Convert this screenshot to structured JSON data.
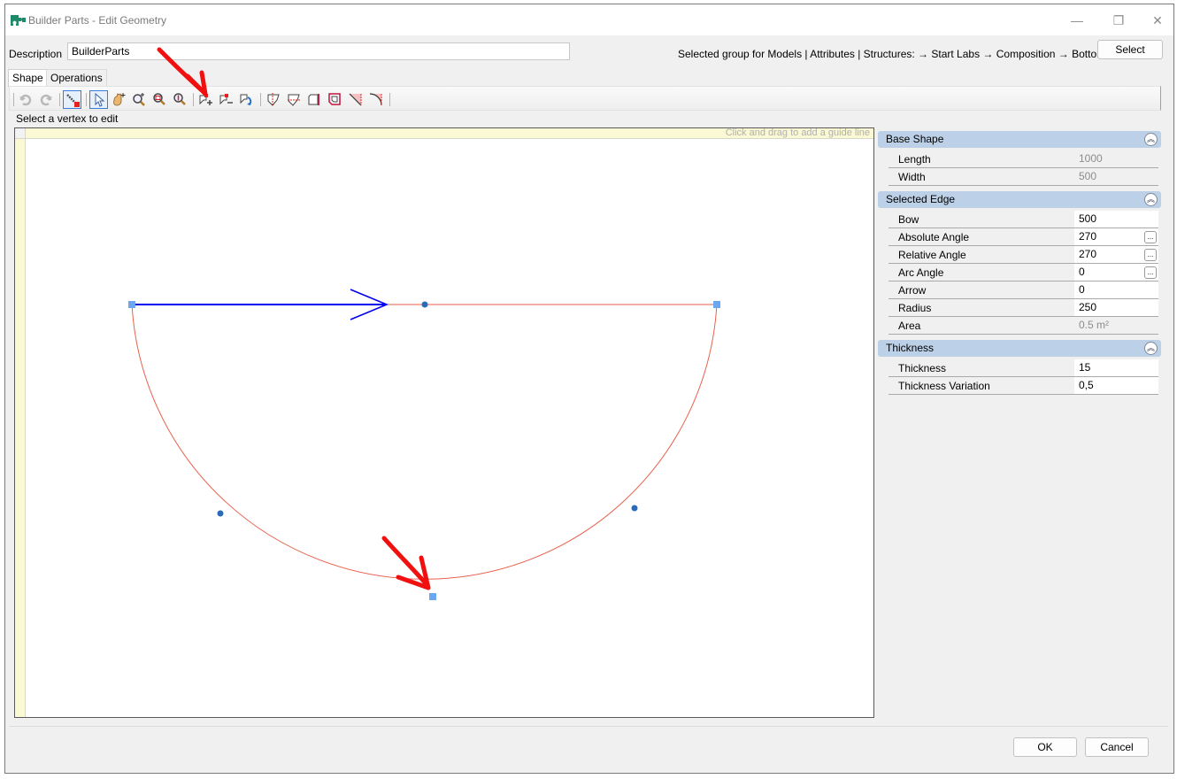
{
  "window": {
    "title": "Builder Parts - Edit Geometry",
    "controls": {
      "minimize": "—",
      "maximize": "❐",
      "close": "✕"
    },
    "app_icon": "puzzle-piece-icon",
    "accent": "#1f8a6a"
  },
  "header": {
    "description_label": "Description",
    "description_value": "BuilderParts",
    "selected_group_text": "Selected group for Models | Attributes | Structures:  → Start Labs → Composition → Bottoms",
    "select_button": "Select"
  },
  "tabs": [
    {
      "label": "Shape",
      "active": true
    },
    {
      "label": "Operations",
      "active": false
    }
  ],
  "toolbar": {
    "items": [
      {
        "icon": "undo-icon",
        "enabled": false
      },
      {
        "icon": "redo-icon",
        "enabled": false
      },
      {
        "icon": "edit-vertex-icon",
        "active": true
      },
      {
        "icon": "select-pointer-icon",
        "active": true
      },
      {
        "icon": "pan-hand-icon"
      },
      {
        "icon": "zoom-in-icon"
      },
      {
        "icon": "zoom-fit-icon"
      },
      {
        "icon": "zoom-extent-icon"
      },
      {
        "icon": "add-vertex-icon"
      },
      {
        "icon": "remove-vertex-icon"
      },
      {
        "icon": "rotate-shape-icon"
      },
      {
        "icon": "split-vertical-icon"
      },
      {
        "icon": "split-horizontal-icon"
      },
      {
        "icon": "cut-edge-icon"
      },
      {
        "icon": "offset-shape-icon"
      },
      {
        "icon": "chamfer-icon"
      },
      {
        "icon": "fillet-icon"
      }
    ]
  },
  "status": {
    "hint": "Select a vertex to edit"
  },
  "canvas": {
    "guide_hint": "Click and drag to add a guide line",
    "edge_color": "#e8604c",
    "selected_edge_color": "#0000ee",
    "vertex_color": "#6aa7f0",
    "midpoint_color": "#2a6ab8"
  },
  "properties": {
    "sections": [
      {
        "title": "Base Shape",
        "rows": [
          {
            "label": "Length",
            "value": "1000",
            "editable": false
          },
          {
            "label": "Width",
            "value": "500",
            "editable": false
          }
        ]
      },
      {
        "title": "Selected Edge",
        "rows": [
          {
            "label": "Bow",
            "value": "500",
            "editable": true
          },
          {
            "label": "Absolute Angle",
            "value": "270",
            "editable": true,
            "ellipsis": "..."
          },
          {
            "label": "Relative Angle",
            "value": "270",
            "editable": true,
            "ellipsis": "..."
          },
          {
            "label": "Arc Angle",
            "value": "0",
            "editable": true,
            "ellipsis": "..."
          },
          {
            "label": "Arrow",
            "value": "0",
            "editable": true
          },
          {
            "label": "Radius",
            "value": "250",
            "editable": true
          },
          {
            "label": "Area",
            "value": "0.5 m²",
            "editable": false
          }
        ]
      },
      {
        "title": "Thickness",
        "rows": [
          {
            "label": "Thickness",
            "value": "15",
            "editable": true
          },
          {
            "label": "Thickness Variation",
            "value": "0,5",
            "editable": true
          }
        ]
      }
    ],
    "collapse_glyph": "︽"
  },
  "footer": {
    "ok": "OK",
    "cancel": "Cancel"
  }
}
